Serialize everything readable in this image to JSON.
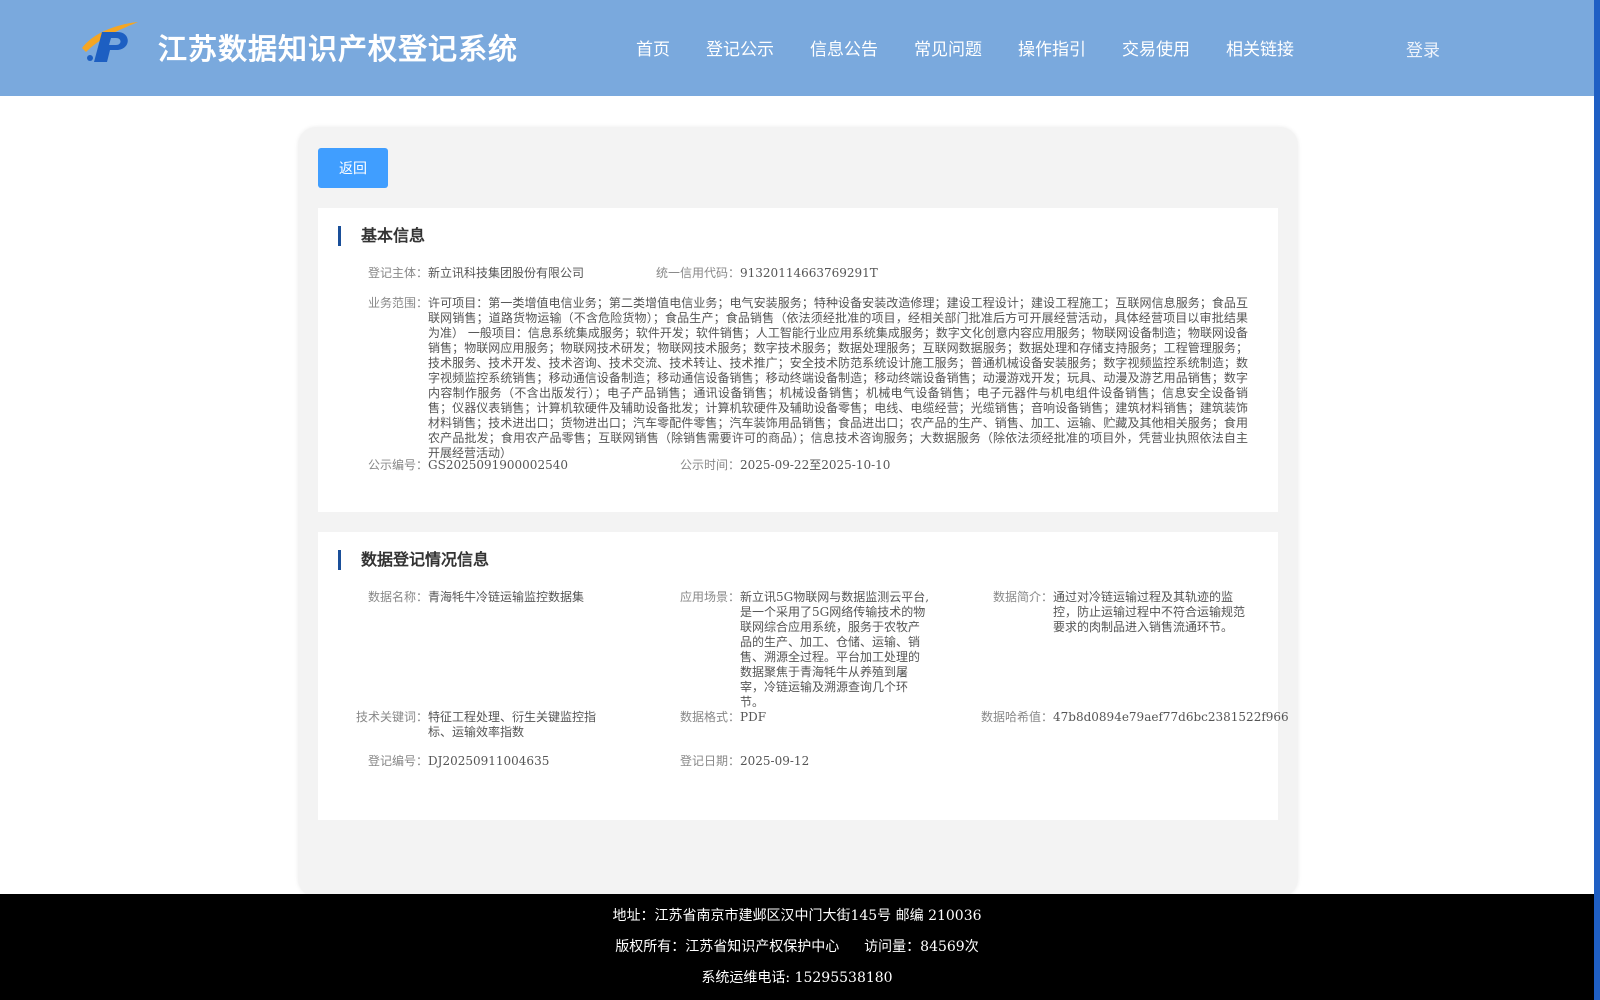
{
  "header": {
    "title": "江苏数据知识产权登记系统",
    "nav": [
      "首页",
      "登记公示",
      "信息公告",
      "常见问题",
      "操作指引",
      "交易使用",
      "相关链接"
    ],
    "login": "登录"
  },
  "back_label": "返回",
  "basic": {
    "title": "基本信息",
    "entity_label": "登记主体：",
    "entity": "新立讯科技集团股份有限公司",
    "credit_label": "统一信用代码：",
    "credit": "91320114663769291T",
    "scope_label": "业务范围：",
    "scope": "许可项目：第一类增值电信业务；第二类增值电信业务；电气安装服务；特种设备安装改造修理；建设工程设计；建设工程施工；互联网信息服务；食品互联网销售；道路货物运输（不含危险货物）；食品生产；食品销售（依法须经批准的项目，经相关部门批准后方可开展经营活动，具体经营项目以审批结果为准） 一般项目：信息系统集成服务；软件开发；软件销售；人工智能行业应用系统集成服务；数字文化创意内容应用服务；物联网设备制造；物联网设备销售；物联网应用服务；物联网技术研发；物联网技术服务；数字技术服务；数据处理服务；互联网数据服务；数据处理和存储支持服务；工程管理服务；技术服务、技术开发、技术咨询、技术交流、技术转让、技术推广；安全技术防范系统设计施工服务；普通机械设备安装服务；数字视频监控系统制造；数字视频监控系统销售；移动通信设备制造；移动通信设备销售；移动终端设备制造；移动终端设备销售；动漫游戏开发；玩具、动漫及游艺用品销售；数字内容制作服务（不含出版发行）；电子产品销售；通讯设备销售；机械设备销售；机械电气设备销售；电子元器件与机电组件设备销售；信息安全设备销售；仪器仪表销售；计算机软硬件及辅助设备批发；计算机软硬件及辅助设备零售；电线、电缆经营；光缆销售；音响设备销售；建筑材料销售；建筑装饰材料销售；技术进出口；货物进出口；汽车零配件零售；汽车装饰用品销售；食品进出口；农产品的生产、销售、加工、运输、贮藏及其他相关服务；食用农产品批发；食用农产品零售；互联网销售（除销售需要许可的商品）；信息技术咨询服务；大数据服务（除依法须经批准的项目外，凭营业执照依法自主开展经营活动）",
    "pub_no_label": "公示编号：",
    "pub_no": "GS2025091900002540",
    "pub_time_label": "公示时间：",
    "pub_time_start": "2025-09-22",
    "pub_time_sep": "至",
    "pub_time_end": "2025-10-10"
  },
  "registration": {
    "title": "数据登记情况信息",
    "name_label": "数据名称：",
    "name": "青海牦牛冷链运输监控数据集",
    "scene_label": "应用场景：",
    "scene": "新立讯5G物联网与数据监测云平台,是一个采用了5G网络传输技术的物联网综合应用系统，服务于农牧产品的生产、加工、仓储、运输、销售、溯源全过程。平台加工处理的数据聚焦于青海牦牛从养殖到屠宰，冷链运输及溯源查询几个环节。",
    "intro_label": "数据简介：",
    "intro": "通过对冷链运输过程及其轨迹的监控，防止运输过程中不符合运输规范要求的肉制品进入销售流通环节。",
    "keywords_label": "技术关键词：",
    "keywords": "特征工程处理、衍生关键监控指标、运输效率指数",
    "format_label": "数据格式：",
    "format": "PDF",
    "hash_label": "数据哈希值：",
    "hash": "47b8d0894e79aef77d6bc2381522f966",
    "reg_no_label": "登记编号：",
    "reg_no": "DJ20250911004635",
    "reg_date_label": "登记日期：",
    "reg_date": "2025-09-12"
  },
  "footer": {
    "address": "地址：江苏省南京市建邺区汉中门大街145号 邮编 210036",
    "copyright": "版权所有：江苏省知识产权保护中心",
    "visits": "访问量：84569次",
    "phone": "系统运维电话: 15295538180"
  },
  "colors": {
    "header_bg": "#7aa9dd",
    "accent_blue": "#409eff",
    "section_bar": "#1a4f99",
    "footer_bg": "#000000"
  }
}
